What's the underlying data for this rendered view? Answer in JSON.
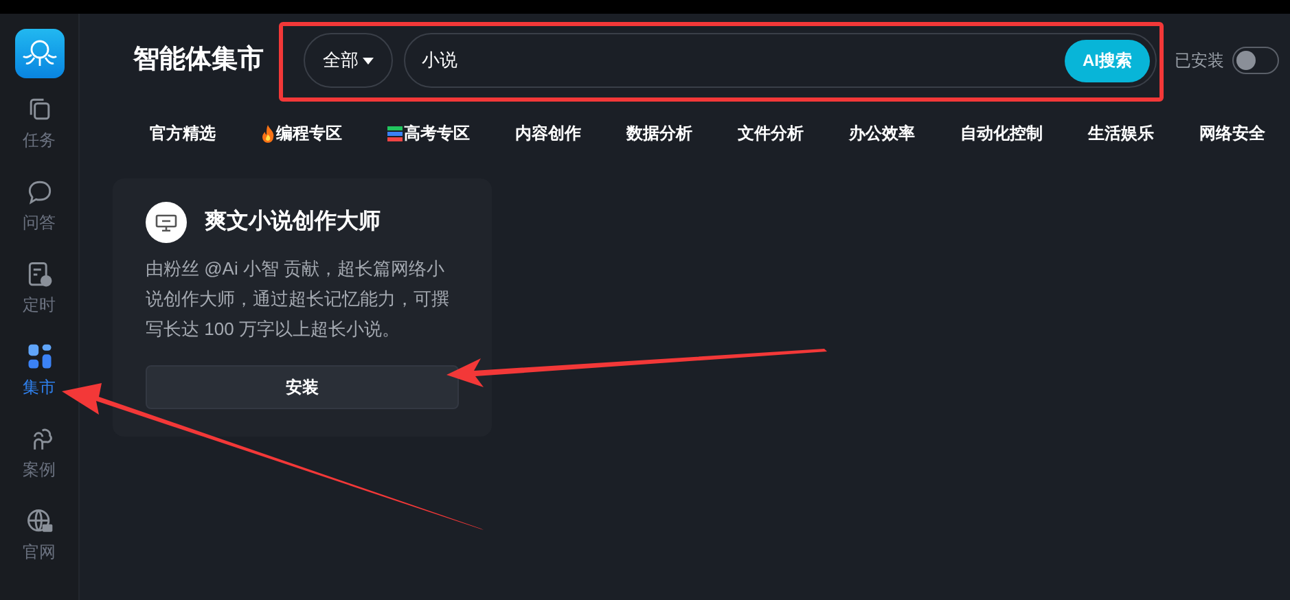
{
  "sidebar": {
    "items": [
      {
        "label": "任务",
        "kind": "tasks",
        "selected": false
      },
      {
        "label": "问答",
        "kind": "chat",
        "selected": false
      },
      {
        "label": "定时",
        "kind": "schedule",
        "selected": false
      },
      {
        "label": "集市",
        "kind": "market",
        "selected": true
      },
      {
        "label": "案例",
        "kind": "cases",
        "selected": false
      },
      {
        "label": "官网",
        "kind": "web",
        "selected": false
      }
    ]
  },
  "header": {
    "title": "智能体集市",
    "filter": "全部",
    "search": {
      "value": "小说"
    },
    "search_button": "AI搜索",
    "installed_toggle": {
      "label": "已安装",
      "on": false
    }
  },
  "categories": [
    {
      "label": "官方精选",
      "kind": "plain"
    },
    {
      "label": "编程专区",
      "kind": "fire"
    },
    {
      "label": "高考专区",
      "kind": "books"
    },
    {
      "label": "内容创作",
      "kind": "plain"
    },
    {
      "label": "数据分析",
      "kind": "plain"
    },
    {
      "label": "文件分析",
      "kind": "plain"
    },
    {
      "label": "办公效率",
      "kind": "plain"
    },
    {
      "label": "自动化控制",
      "kind": "plain"
    },
    {
      "label": "生活娱乐",
      "kind": "plain"
    },
    {
      "label": "网络安全",
      "kind": "plain"
    }
  ],
  "cards": [
    {
      "title": "爽文小说创作大师",
      "description": "由粉丝 @Ai 小智 贡献，超长篇网络小说创作大师，通过超长记忆能力，可撰写长达 100 万字以上超长小说。",
      "button": "安装"
    }
  ]
}
